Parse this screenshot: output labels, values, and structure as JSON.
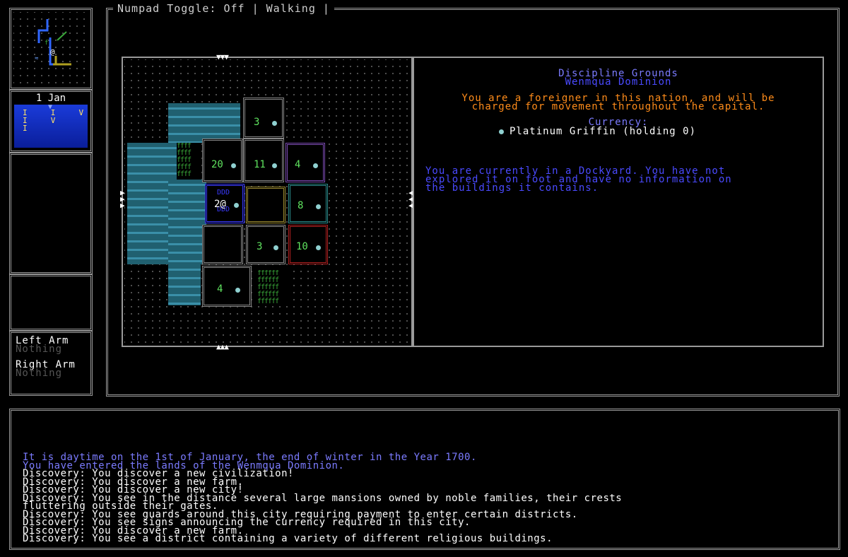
{
  "header": {
    "status": "Numpad Toggle: Off | Walking |"
  },
  "calendar": {
    "date": "1 Jan"
  },
  "equipment": {
    "left_label": "Left Arm",
    "left_value": "Nothing",
    "right_label": "Right Arm",
    "right_value": "Nothing"
  },
  "map": {
    "buildings": [
      {
        "id": "b-top",
        "num": "3"
      },
      {
        "id": "b-20",
        "num": "20"
      },
      {
        "id": "b-11",
        "num": "11"
      },
      {
        "id": "b-4a",
        "num": "4"
      },
      {
        "id": "b-2",
        "num": "2@"
      },
      {
        "id": "b-8",
        "num": "8"
      },
      {
        "id": "b-3b",
        "num": "3"
      },
      {
        "id": "b-10",
        "num": "10"
      },
      {
        "id": "b-4b",
        "num": "4"
      }
    ]
  },
  "info": {
    "title": "Discipline Grounds",
    "subtitle": "Wenmqua Dominion",
    "warning_line1": "You are a foreigner in this nation, and will be",
    "warning_line2": "charged for movement throughout the capital.",
    "currency_label": "Currency:",
    "currency_value": "Platinum Griffin (holding 0)",
    "dock_line1": "You are currently in a Dockyard. You have not",
    "dock_line2": "explored it on foot and have no information on",
    "dock_line3": "the buildings it contains."
  },
  "log": {
    "lines": [
      "It is daytime on the 1st of January, the end of winter in the Year 1700.",
      "You have entered the lands of the Wenmqua Dominion.",
      "Discovery: You discover a new civilization!",
      "Discovery: You discover a new farm.",
      "Discovery: You discover a new city!",
      "Discovery: You see in the distance several large mansions owned by noble families, their crests",
      "fluttering outside their gates.",
      "Discovery: You see guards around this city requiring payment to enter certain districts.",
      "Discovery: You see signs announcing the currency required in this city.",
      "Discovery: You discover a new farm.",
      "Discovery: You see a district containing a variety of different religious buildings."
    ]
  },
  "colors": {
    "title_blue": "#7b7bff",
    "warning_orange": "#ff8c1a",
    "info_blue": "#4a4aff",
    "log_first": "#7b7bff",
    "log_second": "#7b7bff",
    "num_green": "#5fe35f"
  }
}
